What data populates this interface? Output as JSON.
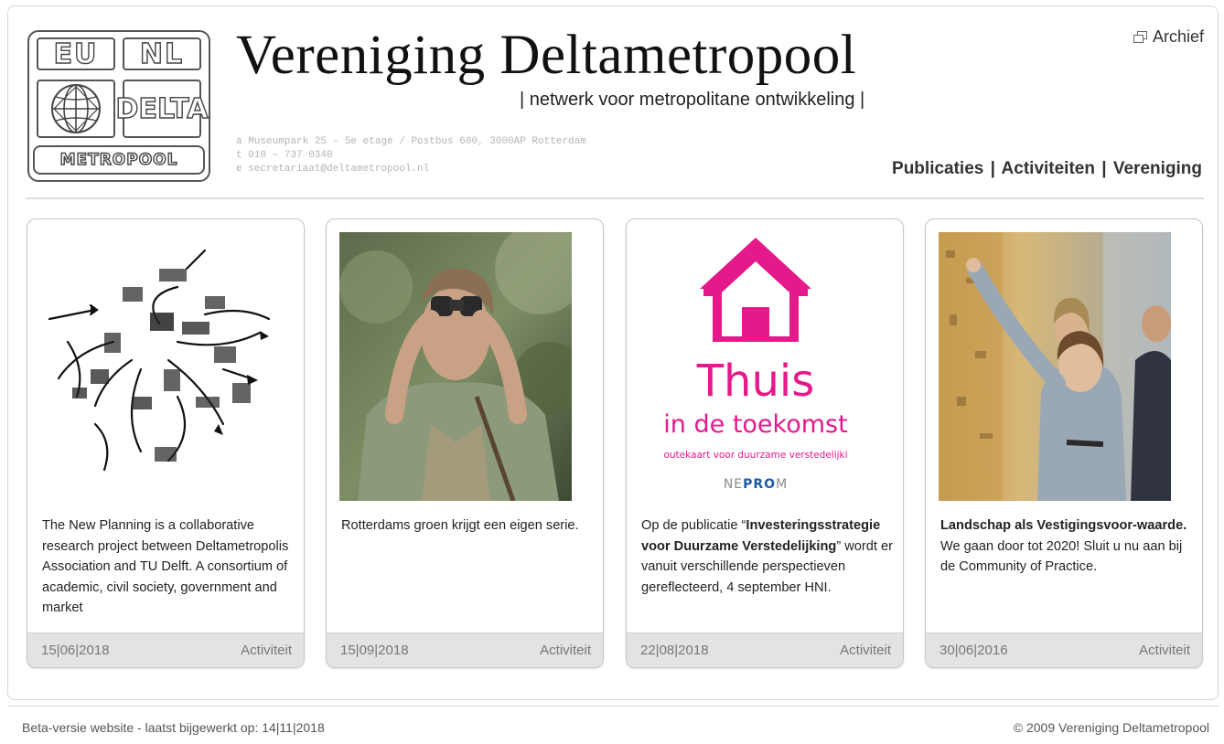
{
  "logo": {
    "eu": "EU",
    "nl": "NL",
    "delta": "DELTA",
    "metropool": "METROPOOL"
  },
  "header": {
    "title": "Vereniging Deltametropool",
    "tagline": "| netwerk voor metropolitane ontwikkeling |",
    "address_line1": "a Museumpark 25 – 5e etage  /  Postbus 600, 3000AP Rotterdam",
    "address_line2": "t 010 – 737 0340",
    "address_line3": "e secretariaat@deltametropool.nl",
    "archive_label": "Archief",
    "archive_icon": "external-window-icon"
  },
  "nav": {
    "items": [
      {
        "label": "Publicaties"
      },
      {
        "label": "Activiteiten"
      },
      {
        "label": "Vereniging"
      }
    ],
    "separator": "|"
  },
  "cards": [
    {
      "image_desc_icon": "sketch-map-diagram",
      "text_plain": "The New Planning is a collaborative research project between Deltametropolis Association and TU Delft. A consortium of academic, civil society, government and market",
      "date": "15|06|2018",
      "category": "Activiteit"
    },
    {
      "image_desc_icon": "man-with-binoculars-photo",
      "text_plain": "Rotterdams groen krijgt een eigen serie.",
      "date": "15|09|2018",
      "category": "Activiteit"
    },
    {
      "image_desc_icon": "house-logo-icon",
      "poster_title": "Thuis",
      "poster_subtitle": "in de toekomst",
      "poster_line": "outekaart voor duurzame verstedelijki",
      "poster_brand_a": "NE",
      "poster_brand_b": "PRO",
      "poster_brand_c": "M",
      "text_pre": "Op de publicatie “",
      "text_bold": "Investeringsstrategie voor Duurzame Verstedelijking",
      "text_post": "” wordt er vanuit verschillende perspectieven gereflecteerd, 4 september HNI.",
      "date": "22|08|2018",
      "category": "Activiteit"
    },
    {
      "image_desc_icon": "woman-pointing-photo",
      "text_bold": "Landschap als Vestigingsvoor-waarde.",
      "text_post": " We gaan door tot 2020! Sluit u nu aan bij de Community of Practice.",
      "date": "30|06|2016",
      "category": "Activiteit"
    }
  ],
  "footer": {
    "left": "Beta-versie website - laatst bijgewerkt op: 14|11|2018",
    "right": "© 2009 Vereniging Deltametropool"
  },
  "colors": {
    "accent_magenta": "#e5198a",
    "nepro_blue": "#1d5aa8",
    "card_footer_bg": "#e3e3e1",
    "text_dark": "#222222"
  }
}
